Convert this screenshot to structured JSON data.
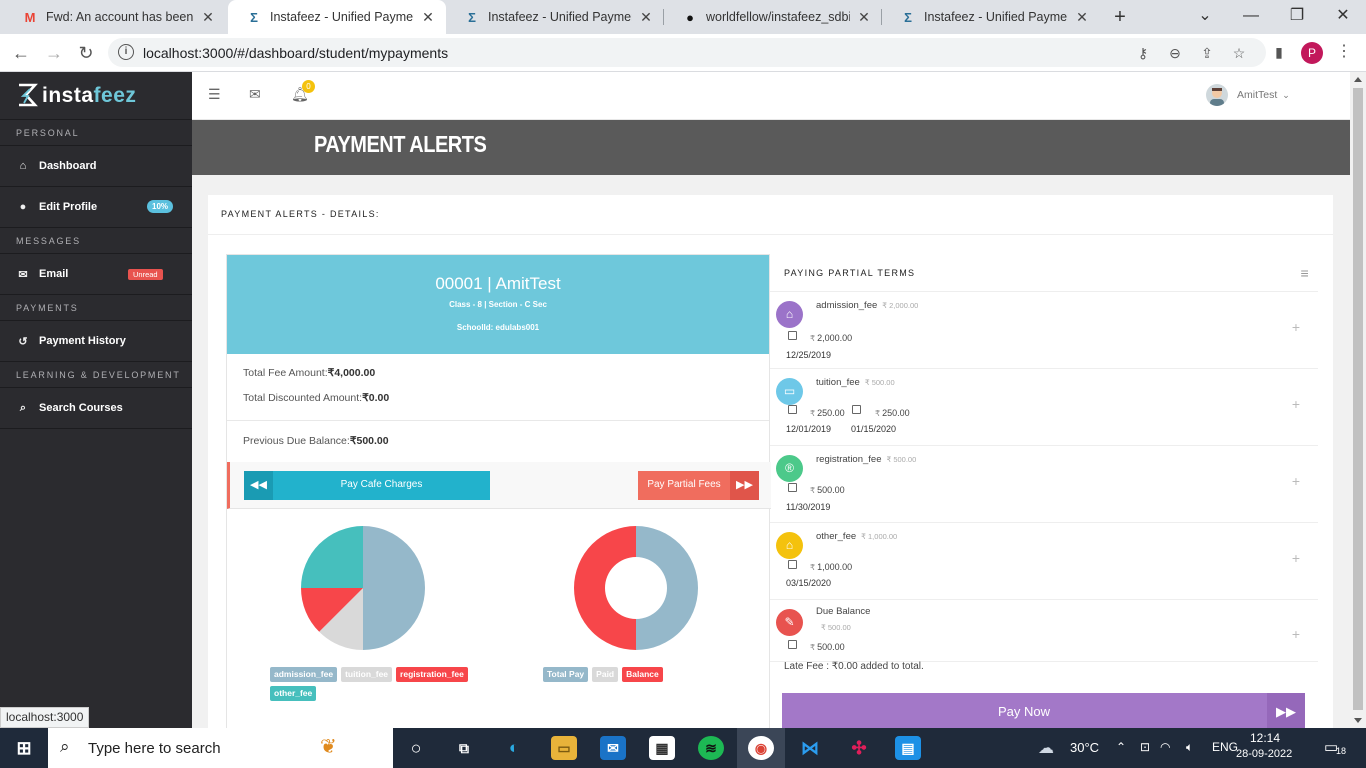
{
  "browser": {
    "tabs": [
      {
        "title": "Fwd: An account has been cr",
        "favicon": "gmail-icon"
      },
      {
        "title": "Instafeez - Unified Payments",
        "favicon": "instafeez-icon",
        "active": true
      },
      {
        "title": "Instafeez - Unified Payments",
        "favicon": "instafeez-icon"
      },
      {
        "title": "worldfellow/instafeez_sdbi",
        "favicon": "github-icon"
      },
      {
        "title": "Instafeez - Unified Payments",
        "favicon": "instafeez-icon"
      }
    ],
    "url": "localhost:3000/#/dashboard/student/mypayments",
    "profile_initial": "P",
    "status_url": "localhost:3000"
  },
  "sidebar": {
    "logo_prefix": "insta",
    "logo_suffix": "feez",
    "sections": [
      {
        "label": "PERSONAL",
        "items": [
          {
            "label": "Dashboard",
            "icon": "home-icon"
          },
          {
            "label": "Edit Profile",
            "icon": "user-icon",
            "badge": "10%"
          }
        ]
      },
      {
        "label": "MESSAGES",
        "items": [
          {
            "label": "Email",
            "icon": "envelope-icon",
            "badge": "Unread"
          }
        ]
      },
      {
        "label": "PAYMENTS",
        "items": [
          {
            "label": "Payment History",
            "icon": "history-icon"
          }
        ]
      },
      {
        "label": "LEARNING & DEVELOPMENT",
        "items": [
          {
            "label": "Search Courses",
            "icon": "search-icon"
          }
        ]
      }
    ]
  },
  "topnav": {
    "notification_count": "0",
    "username": "AmitTest"
  },
  "page": {
    "title": "PAYMENT ALERTS",
    "panel_title": "PAYMENT ALERTS - DETAILS:"
  },
  "student": {
    "header": "00001 | AmitTest",
    "class_line": "Class - 8 | Section - C Sec",
    "school_line": "SchoolId: edulabs001",
    "total_fee_label": "Total Fee Amount:",
    "total_fee_value": "₹4,000.00",
    "discount_label": "Total Discounted Amount:",
    "discount_value": "₹0.00",
    "prev_due_label": "Previous Due Balance:",
    "prev_due_value": "₹500.00",
    "btn_cafe": "Pay Cafe Charges",
    "btn_partial": "Pay Partial Fees"
  },
  "charts": {
    "pie": {
      "legend": [
        {
          "label": "admission_fee",
          "color": "#95b8ca"
        },
        {
          "label": "tuition_fee",
          "color": "#d9d9d9"
        },
        {
          "label": "registration_fee",
          "color": "#f7464a"
        },
        {
          "label": "other_fee",
          "color": "#46bfbd"
        }
      ]
    },
    "doughnut": {
      "legend": [
        {
          "label": "Total Pay",
          "color": "#95b8ca"
        },
        {
          "label": "Paid",
          "color": "#d9d9d9"
        },
        {
          "label": "Balance",
          "color": "#f7464a"
        }
      ]
    }
  },
  "terms": {
    "title": "PAYING PARTIAL TERMS",
    "items": [
      {
        "name": "admission_fee",
        "amount": "₹ 2,000.00",
        "color": "#9b73c9",
        "icon": "bank-icon",
        "parts": [
          {
            "value": "2,000.00",
            "date": "12/25/2019"
          }
        ]
      },
      {
        "name": "tuition_fee",
        "amount": "₹ 500.00",
        "color": "#6ec8e8",
        "icon": "book-icon",
        "parts": [
          {
            "value": "250.00",
            "date": "12/01/2019"
          },
          {
            "value": "250.00",
            "date": "01/15/2020"
          }
        ]
      },
      {
        "name": "registration_fee",
        "amount": "₹ 500.00",
        "color": "#4cc98a",
        "icon": "registered-icon",
        "parts": [
          {
            "value": "500.00",
            "date": "11/30/2019"
          }
        ]
      },
      {
        "name": "other_fee",
        "amount": "₹ 1,000.00",
        "color": "#f4c20d",
        "icon": "bank-icon",
        "parts": [
          {
            "value": "1,000.00",
            "date": "03/15/2020"
          }
        ]
      },
      {
        "name": "Due Balance",
        "amount": "₹ 500.00",
        "color": "#e8534f",
        "icon": "chat-icon",
        "parts": [
          {
            "value": "500.00",
            "date": ""
          }
        ]
      }
    ],
    "late_fee": "Late Fee : ₹0.00 added to total.",
    "pay_now": "Pay Now"
  },
  "taskbar": {
    "search_placeholder": "Type here to search",
    "weather": "30°C",
    "lang": "ENG",
    "time": "12:14",
    "date": "28-09-2022",
    "notif_count": "18"
  }
}
